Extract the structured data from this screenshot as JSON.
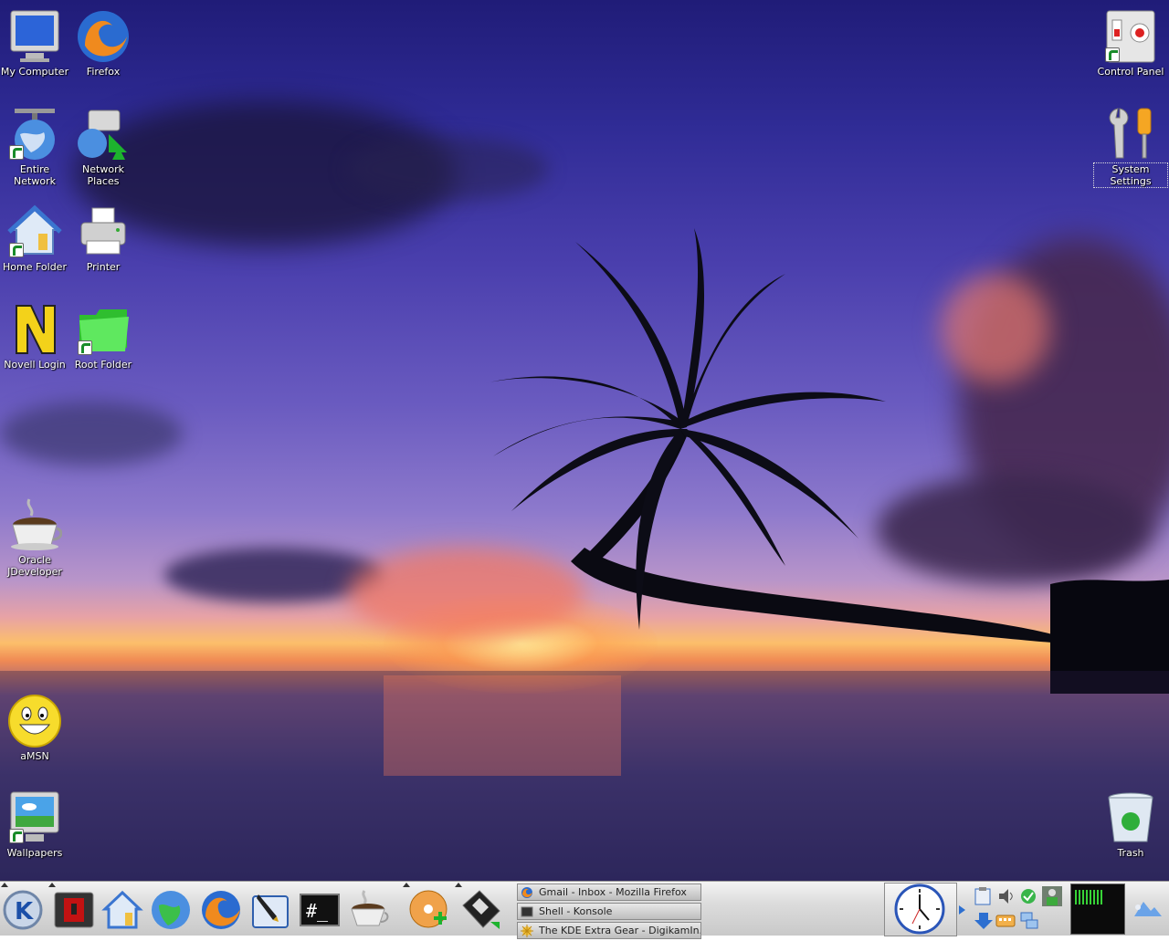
{
  "desktop": {
    "icons_left": [
      {
        "label": "My Computer",
        "icon": "monitor-icon"
      },
      {
        "label": "Firefox",
        "icon": "firefox-icon"
      },
      {
        "label": "Entire Network",
        "icon": "network-globe-icon"
      },
      {
        "label": "Network Places",
        "icon": "network-places-icon"
      },
      {
        "label": "Home Folder",
        "icon": "home-folder-icon"
      },
      {
        "label": "Printer",
        "icon": "printer-icon"
      },
      {
        "label": "Novell Login",
        "icon": "novell-icon"
      },
      {
        "label": "Root Folder",
        "icon": "green-folder-icon"
      },
      {
        "label": "Oracle JDeveloper",
        "icon": "coffee-cup-icon"
      },
      {
        "label": "aMSN",
        "icon": "smiley-icon"
      },
      {
        "label": "Wallpapers",
        "icon": "wallpaper-icon"
      }
    ],
    "icons_right": [
      {
        "label": "Control Panel",
        "icon": "control-panel-icon"
      },
      {
        "label": "System Settings",
        "icon": "wrench-screwdriver-icon"
      },
      {
        "label": "Trash",
        "icon": "trash-icon"
      }
    ]
  },
  "taskbar": {
    "launchers": [
      "kde-menu-icon",
      "logout-icon",
      "home-icon",
      "browser-globe-icon",
      "firefox-icon",
      "text-editor-icon",
      "terminal-icon",
      "jdeveloper-icon",
      "cd-burn-icon",
      "floppy-icon"
    ],
    "tasks": [
      {
        "title": "Gmail - Inbox - Mozilla Firefox",
        "icon": "firefox-icon"
      },
      {
        "title": "Shell - Konsole",
        "icon": "terminal-icon"
      },
      {
        "title": "The KDE Extra Gear - DigikamIn...",
        "icon": "digikam-icon"
      }
    ],
    "tray_icons": [
      "clipboard-icon",
      "volume-icon",
      "checkmark-icon",
      "network-user-icon",
      "download-icon",
      "keyboard-icon",
      "network-monitor-icon"
    ],
    "colors": {
      "panel": "#d4d4d4",
      "accent": "#2d6fd0"
    }
  }
}
